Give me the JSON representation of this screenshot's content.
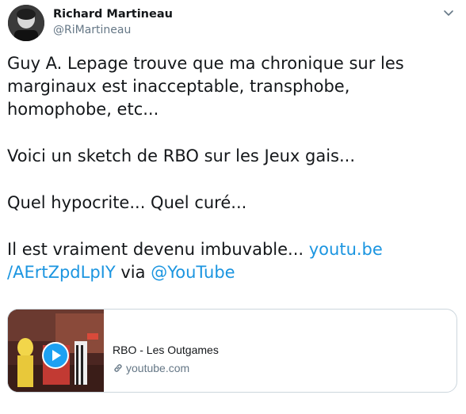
{
  "author": {
    "name": "Richard Martineau",
    "handle": "@RiMartineau"
  },
  "tweet": {
    "line1": "Guy A. Lepage trouve que ma chronique sur les marginaux est inacceptable, transphobe, homophobe, etc...",
    "line2": "Voici un sketch de RBO sur les Jeux gais...",
    "line3": "Quel hypocrite... Quel curé...",
    "line4_text": "Il est vraiment devenu imbuvable...",
    "link": "youtu.be /AErtZpdLpIY",
    "via": "via",
    "mention": "@YouTube"
  },
  "card": {
    "title": "RBO - Les Outgames",
    "domain": "youtube.com"
  },
  "icons": {
    "menu": "chevron-down-icon",
    "play": "play-icon",
    "link": "link-icon"
  },
  "colors": {
    "link": "#1b95e0",
    "secondary_text": "#657786",
    "play_button": "#1da1f2"
  }
}
